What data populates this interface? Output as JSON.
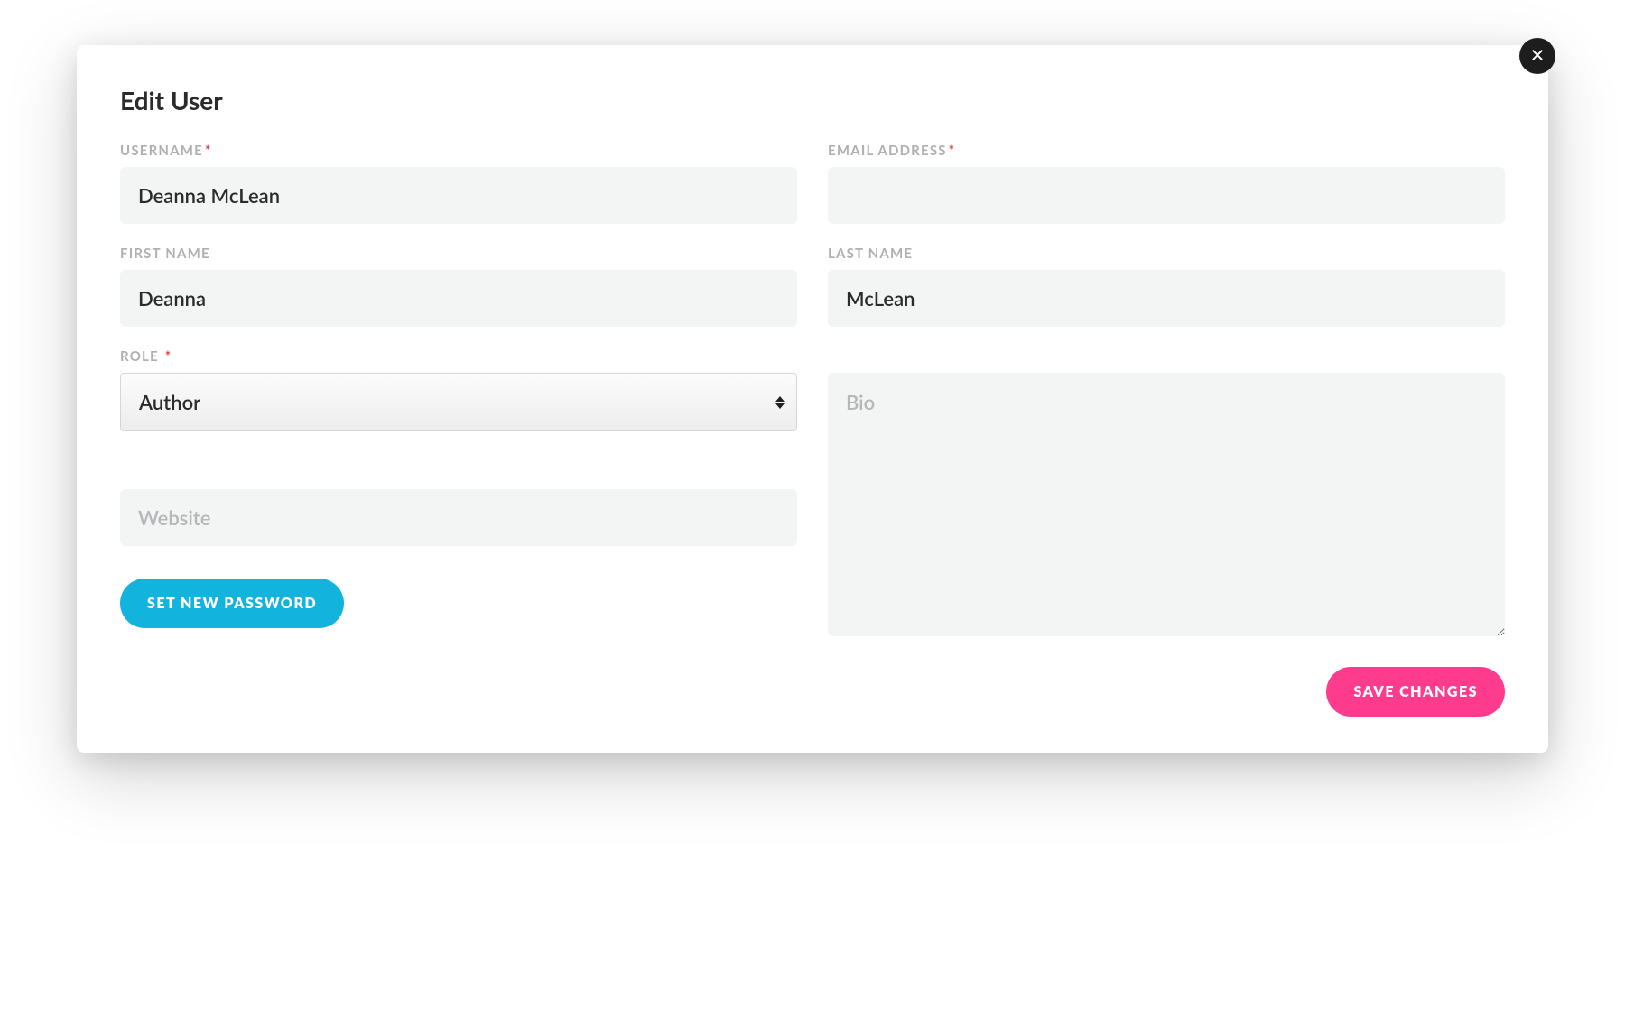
{
  "modal": {
    "title": "Edit User",
    "close_icon": "close"
  },
  "labels": {
    "username": "USERNAME",
    "email": "EMAIL ADDRESS",
    "first_name": "FIRST NAME",
    "last_name": "LAST NAME",
    "role": "ROLE",
    "required_marker": "*"
  },
  "fields": {
    "username": "Deanna McLean",
    "email": "    ",
    "first_name": "Deanna",
    "last_name": "McLean",
    "role_selected": "Author",
    "website_placeholder": "Website",
    "bio_placeholder": "Bio"
  },
  "buttons": {
    "set_password": "SET NEW PASSWORD",
    "save": "SAVE CHANGES"
  }
}
